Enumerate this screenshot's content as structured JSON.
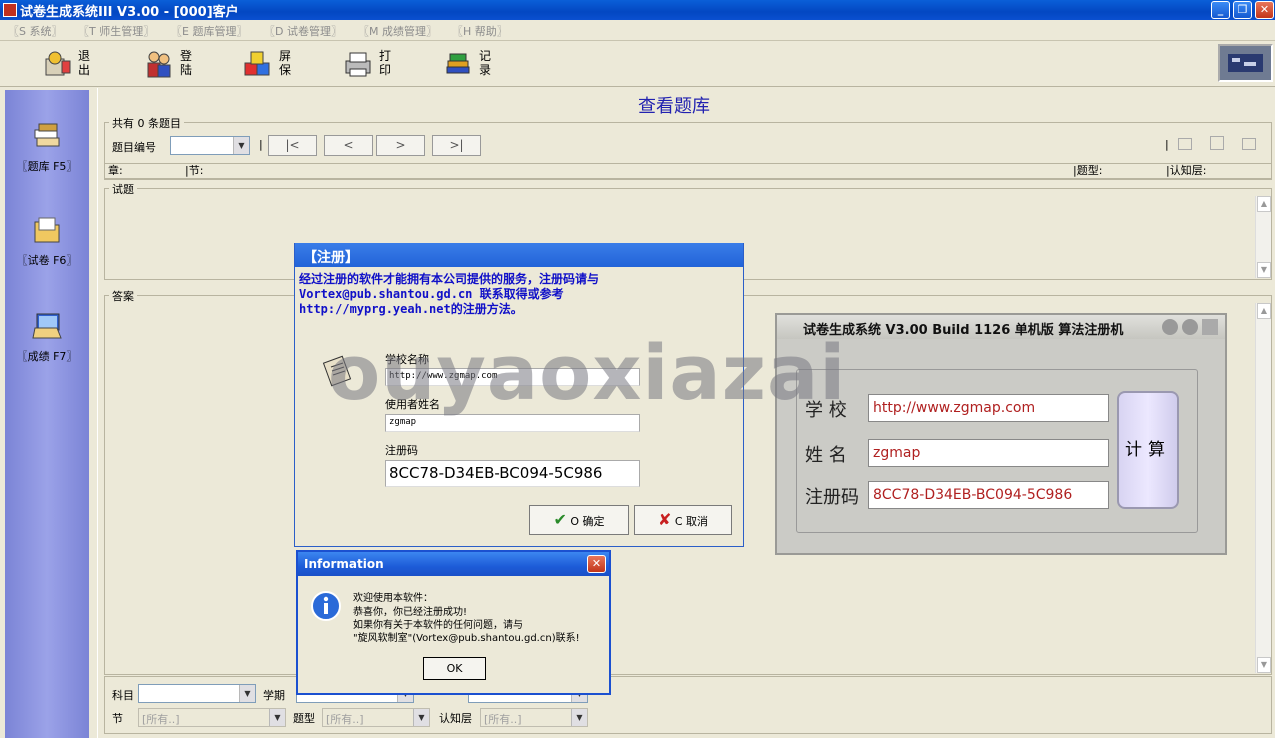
{
  "window": {
    "title": "试卷生成系统III V3.00 - [000]客户"
  },
  "menu": [
    "〖S 系统〗",
    "〖T 师生管理〗",
    "〖E 题库管理〗",
    "〖D 试卷管理〗",
    "〖M 成绩管理〗",
    "〖H 帮助〗"
  ],
  "toolbar": [
    {
      "label": "退出",
      "icon": "exit-icon"
    },
    {
      "label": "登陆",
      "icon": "login-icon"
    },
    {
      "label": "屏保",
      "icon": "screensaver-icon"
    },
    {
      "label": "打印",
      "icon": "printer-icon"
    },
    {
      "label": "记录",
      "icon": "records-icon"
    }
  ],
  "sidebar": [
    {
      "label": "〖题库 F5〗",
      "icon": "question-bank-icon"
    },
    {
      "label": "〖试卷 F6〗",
      "icon": "exam-paper-icon"
    },
    {
      "label": "〖成绩 F7〗",
      "icon": "grades-icon"
    }
  ],
  "main": {
    "title": "查看题库",
    "count_label": "共有 0 条题目",
    "id_label": "题目编号",
    "nav_buttons": [
      "|<",
      "<",
      ">",
      ">|"
    ],
    "columns": {
      "chapter": "章:",
      "section": "|节:",
      "type": "|题型:",
      "cognition": "|认知层:"
    },
    "question_label": "试题",
    "answer_label": "答案"
  },
  "filters": {
    "subject": "科目",
    "term": "学期",
    "section": "节",
    "section_value": "[所有..]",
    "type": "题型",
    "type_value": "[所有..]",
    "cognition": "认知层",
    "cognition_value": "[所有..]"
  },
  "register_dialog": {
    "title": "【注册】",
    "msg1": "    经过注册的软件才能拥有本公司提供的服务，注册码请与",
    "msg2": "Vortex@pub.shantou.gd.cn 联系取得或参考",
    "msg3": "http://myprg.yeah.net的注册方法。",
    "school_label": "学校名称",
    "school_value": "http://www.zgmap.com",
    "user_label": "使用者姓名",
    "user_value": "zgmap",
    "code_label": "注册码",
    "code_value": "8CC78-D34EB-BC094-5C986",
    "ok": "O 确定",
    "cancel": "C 取消"
  },
  "info_dialog": {
    "title": "Information",
    "lines": [
      "欢迎使用本软件：",
      "    恭喜你，你已经注册成功!",
      "    如果你有关于本软件的任何问题，请与",
      "\"旋风软制室\"(Vortex@pub.shantou.gd.cn)联系!"
    ],
    "ok": "OK"
  },
  "keygen": {
    "title": "试卷生成系统 V3.00 Build 1126 单机版 算法注册机",
    "school_label": "学  校",
    "school_value": "http://www.zgmap.com",
    "name_label": "姓  名",
    "name_value": "zgmap",
    "code_label": "注册码",
    "code_value": "8CC78-D34EB-BC094-5C986",
    "calc": "计算"
  },
  "watermark": "ouyaoxiazai",
  "colors": {
    "titlebar": "#0a4fd0",
    "nav": "#8a92e0",
    "title_text": "#2222b0",
    "reg_text": "#1010c8",
    "keygen_text": "#b02020"
  }
}
